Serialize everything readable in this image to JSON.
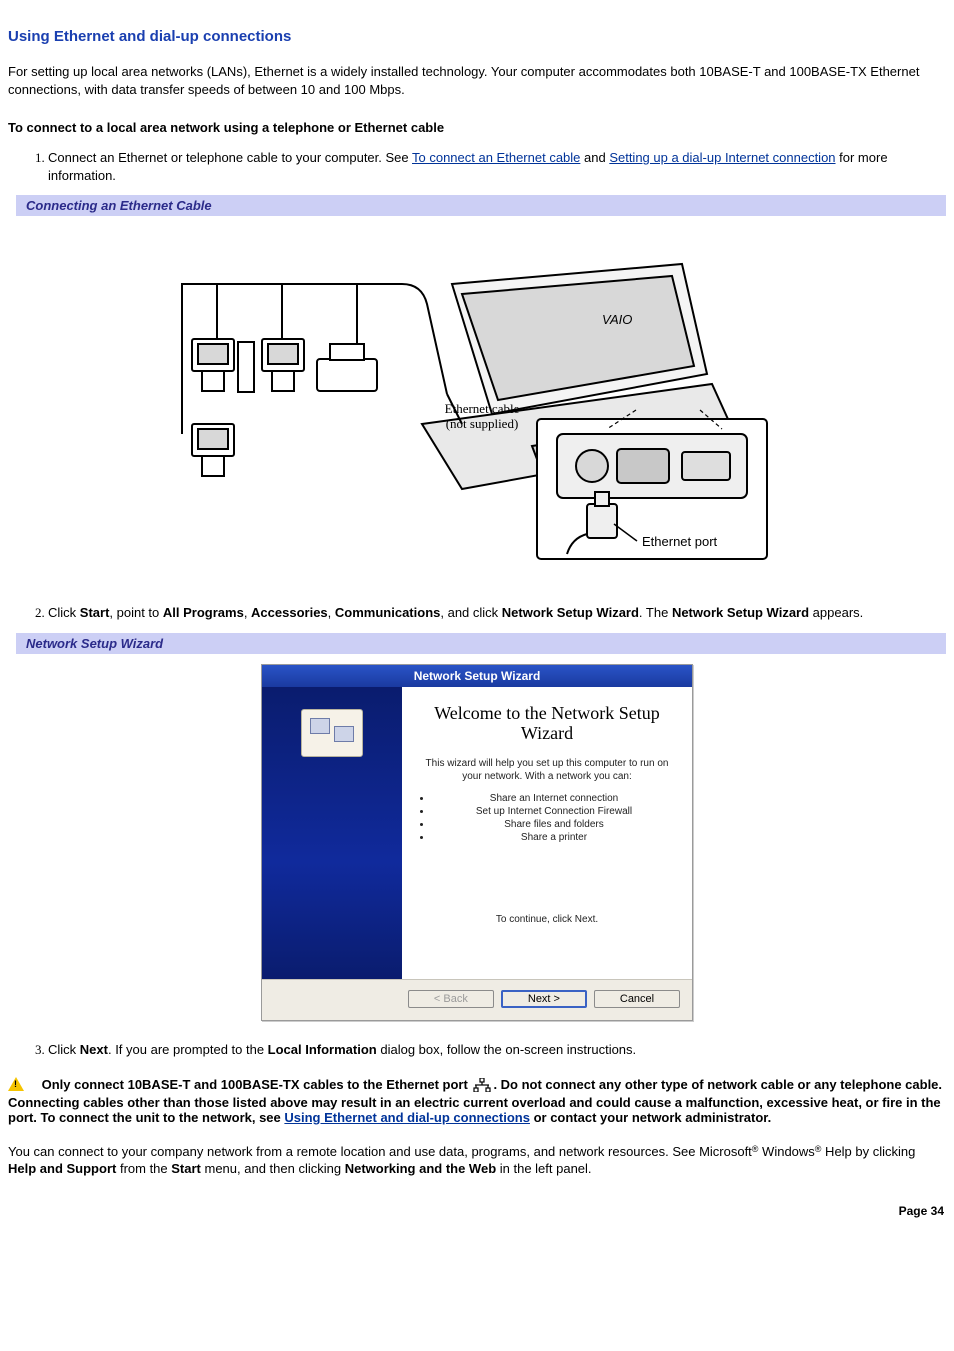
{
  "title": "Using Ethernet and dial-up connections",
  "intro": "For setting up local area networks (LANs), Ethernet is a widely installed technology. Your computer accommodates both 10BASE-T and 100BASE-TX Ethernet connections, with data transfer speeds of between 10 and 100 Mbps.",
  "subhead": "To connect to a local area network using a telephone or Ethernet cable",
  "step1_pre": "Connect an Ethernet or telephone cable to your computer. See ",
  "step1_link1": "To connect an Ethernet cable",
  "step1_mid": " and ",
  "step1_link2": "Setting up a dial-up Internet connection",
  "step1_post": " for more information.",
  "band1": "Connecting an Ethernet Cable",
  "fig1": {
    "label_cable": "Ethernet cable (not supplied)",
    "label_port": "Ethernet port",
    "laptop_brand": "VAIO"
  },
  "step2_a": "Click ",
  "step2_b": "Start",
  "step2_c": ", point to ",
  "step2_d": "All Programs",
  "step2_e": ", ",
  "step2_f": "Accessories",
  "step2_g": ", ",
  "step2_h": "Communications",
  "step2_i": ", and click ",
  "step2_j": "Network Setup Wizard",
  "step2_k": ". The ",
  "step2_l": "Network Setup Wizard",
  "step2_m": " appears.",
  "band2": "Network Setup Wizard",
  "wizard": {
    "titlebar": "Network Setup Wizard",
    "heading": "Welcome to the Network Setup Wizard",
    "para": "This wizard will help you set up this computer to run on your network. With a network you can:",
    "bullets": [
      "Share an Internet connection",
      "Set up Internet Connection Firewall",
      "Share files and folders",
      "Share a printer"
    ],
    "continue": "To continue, click Next.",
    "btn_back": "< Back",
    "btn_next": "Next >",
    "btn_cancel": "Cancel"
  },
  "step3_a": "Click ",
  "step3_b": "Next",
  "step3_c": ". If you are prompted to the ",
  "step3_d": "Local Information",
  "step3_e": " dialog box, follow the on-screen instructions.",
  "warning_a": "Only connect 10BASE-T and 100BASE-TX cables to the Ethernet port ",
  "warning_b": ". Do not connect any other type of network cable or any telephone cable. Connecting cables other than those listed above may result in an electric current overload and could cause a malfunction, excessive heat, or fire in the port. To connect the unit to the network, see ",
  "warning_link": "Using Ethernet and dial-up connections",
  "warning_c": " or contact your network administrator.",
  "closing_a": "You can connect to your company network from a remote location and use data, programs, and network resources. See Microsoft",
  "closing_b": " Windows",
  "closing_c": " Help by clicking ",
  "closing_d": "Help and Support",
  "closing_e": " from the ",
  "closing_f": "Start",
  "closing_g": " menu, and then clicking ",
  "closing_h": "Networking and the Web",
  "closing_i": " in the left panel.",
  "reg": "®",
  "page_number": "Page 34"
}
